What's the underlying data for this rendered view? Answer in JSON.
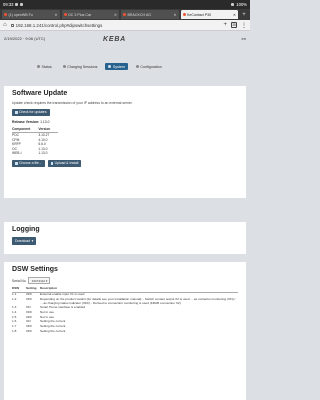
{
  "status_bar": {
    "time": "09:33",
    "right_text": "100%"
  },
  "browser": {
    "tabs": [
      {
        "label": "(1) openWB Fo",
        "active": false
      },
      {
        "label": "OC 3 Plus Car",
        "active": false
      },
      {
        "label": "BRACKCH AG",
        "active": false
      },
      {
        "label": "KeContact P30",
        "active": true
      }
    ],
    "tab_count": "35",
    "url": "192.168.1.241/control.php#dipswitchsettings"
  },
  "app_header": {
    "refresh_label": "2/19/2022 · 9:06 (UTC)",
    "logo": "KEBA",
    "right_label": "en"
  },
  "menu": {
    "items": [
      {
        "label": "Status",
        "active": false
      },
      {
        "label": "Charging Sessions",
        "active": false
      },
      {
        "label": "System",
        "active": true
      },
      {
        "label": "Configuration",
        "active": false
      }
    ]
  },
  "software_update": {
    "title": "Software Update",
    "description": "Update check requires the transmission of your IP address to an external server.",
    "check_button": "Check for updates",
    "release_label": "Release Version:",
    "release_value": "1.13.0",
    "table_headers": [
      "Component",
      "Version"
    ],
    "components": [
      {
        "name": "PDC",
        "version": "3.10.27"
      },
      {
        "name": "CPM",
        "version": "4.10.0"
      },
      {
        "name": "KRFP",
        "version": "6.6.0"
      },
      {
        "name": "OC",
        "version": "1.13.0"
      },
      {
        "name": "WEB-I",
        "version": "1.13.0"
      }
    ],
    "choose_button": "Choose a file...",
    "upload_button": "Upload & Install"
  },
  "logging": {
    "title": "Logging",
    "download_button": "Download"
  },
  "dsw_settings": {
    "title": "DSW Settings",
    "serial_label": "Serial No.",
    "serial_value": "19474112",
    "headers": [
      "DSW",
      "Setting",
      "Description"
    ],
    "rows": [
      {
        "dsw": "1.1",
        "setting": "OFF",
        "description": "External enable input X1 is used"
      },
      {
        "dsw": "1.2",
        "setting": "OFF",
        "description": "Depending on the product variant (for details see your installation manual): - Switch contact output X2 is used ... as contactor monitoring (ON) / ... as charging status indicator (OFF) - Derived to connection monitoring is used (KRAB connection X2)"
      },
      {
        "dsw": "1.3",
        "setting": "ON",
        "description": "Smart Home interface is enabled"
      },
      {
        "dsw": "1.4",
        "setting": "OFF",
        "description": "Not in use"
      },
      {
        "dsw": "1.5",
        "setting": "OFF",
        "description": "Not in use"
      },
      {
        "dsw": "1.6",
        "setting": "ON",
        "description": "Setting the current"
      },
      {
        "dsw": "1.7",
        "setting": "OFF",
        "description": "Setting the current"
      },
      {
        "dsw": "1.8",
        "setting": "OFF",
        "description": "Setting the current"
      }
    ]
  }
}
